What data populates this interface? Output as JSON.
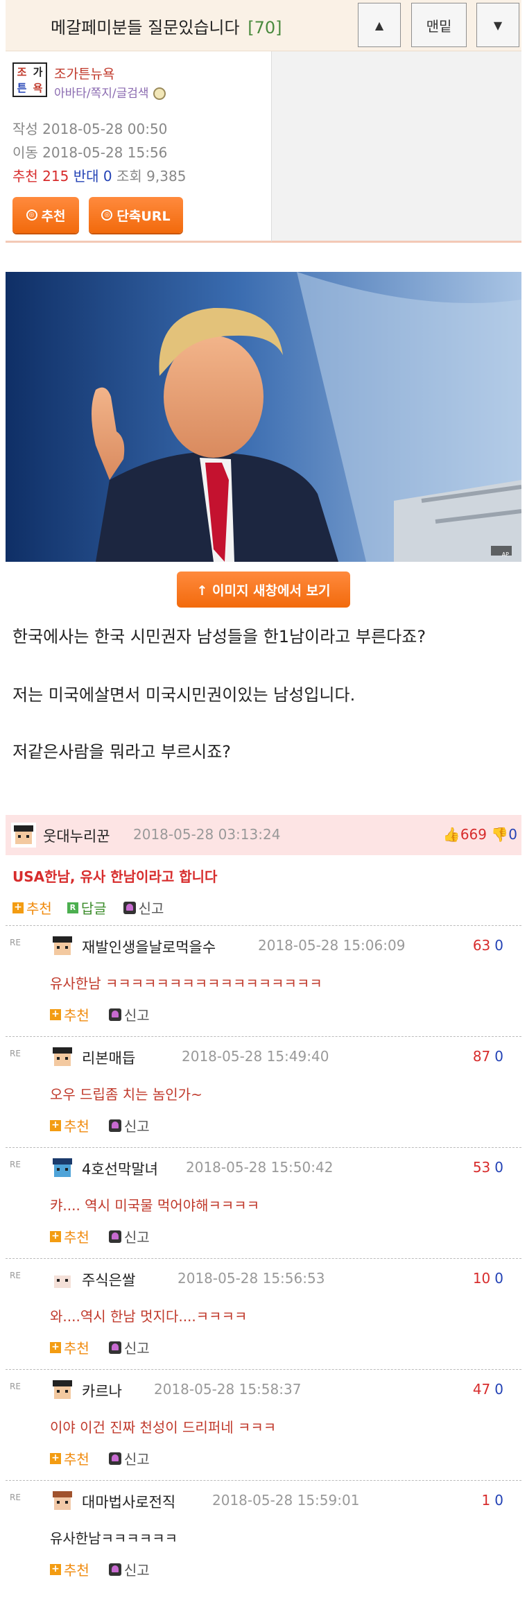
{
  "header": {
    "title": "메갈페미분들 질문있습니다",
    "comment_count": "[70]",
    "up_icon": "▲",
    "bottom_label": "맨밑",
    "down_icon": "▼"
  },
  "post": {
    "author": "조가튼뉴욕",
    "author_links": "아바타/쪽지/글검색",
    "avatar_text": [
      "조",
      "가",
      "튼",
      "욕"
    ],
    "written_label": "작성",
    "written_at": "2018-05-28 00:50",
    "moved_label": "이동",
    "moved_at": "2018-05-28 15:56",
    "recommend_label": "추천",
    "recommend_count": "215",
    "oppose_label": "반대",
    "oppose_count": "0",
    "views_label": "조회",
    "views_count": "9,385",
    "recommend_button": "추천",
    "short_url_button": "단축URL",
    "open_image_button": "↑ 이미지 새창에서 보기",
    "image_credit": "AP",
    "body": [
      "한국에사는 한국 시민권자 남성들을 한1남이라고 부른다죠?",
      "저는 미국에살면서 미국시민권이있는 남성입니다.",
      "저같은사람을 뭐라고 부르시죠?"
    ]
  },
  "comments": {
    "best": {
      "name": "웃대누리꾼",
      "date": "2018-05-28 03:13:24",
      "up": "669",
      "down": "0",
      "text": "USA한남, 유사 한남이라고 합니다",
      "recommend_label": "추천",
      "reply_label": "답글",
      "report_label": "신고"
    },
    "re_label": "RE",
    "replies": [
      {
        "name": "재발인생을날로먹을수",
        "date": "2018-05-28 15:06:09",
        "up": "63",
        "down": "0",
        "text": "유사한남 ㅋㅋㅋㅋㅋㅋㅋㅋㅋㅋㅋㅋㅋㅋㅋㅋㅋ",
        "recommend_label": "추천",
        "report_label": "신고",
        "text_color": "#c0392b"
      },
      {
        "name": "리본매듭",
        "date": "2018-05-28 15:49:40",
        "up": "87",
        "down": "0",
        "text": "오우 드립좀 치는 놈인가~",
        "recommend_label": "추천",
        "report_label": "신고",
        "text_color": "#c0392b"
      },
      {
        "name": "4호선막말녀",
        "date": "2018-05-28 15:50:42",
        "up": "53",
        "down": "0",
        "text": "캬.... 역시 미국물 먹어야해ㅋㅋㅋㅋ",
        "recommend_label": "추천",
        "report_label": "신고",
        "text_color": "#c0392b"
      },
      {
        "name": "주식은쌀",
        "date": "2018-05-28 15:56:53",
        "up": "10",
        "down": "0",
        "text": "와....역시 한남 멋지다....ㅋㅋㅋㅋ",
        "recommend_label": "추천",
        "report_label": "신고",
        "text_color": "#c0392b"
      },
      {
        "name": "카르나",
        "date": "2018-05-28 15:58:37",
        "up": "47",
        "down": "0",
        "text": "이야 이건 진짜 천성이 드리퍼네 ㅋㅋㅋ",
        "recommend_label": "추천",
        "report_label": "신고",
        "text_color": "#c0392b"
      },
      {
        "name": "대마법사로전직",
        "date": "2018-05-28 15:59:01",
        "up": "1",
        "down": "0",
        "text": "유사한남ㅋㅋㅋㅋㅋㅋ",
        "recommend_label": "추천",
        "report_label": "신고",
        "text_color": "#222222"
      }
    ]
  }
}
